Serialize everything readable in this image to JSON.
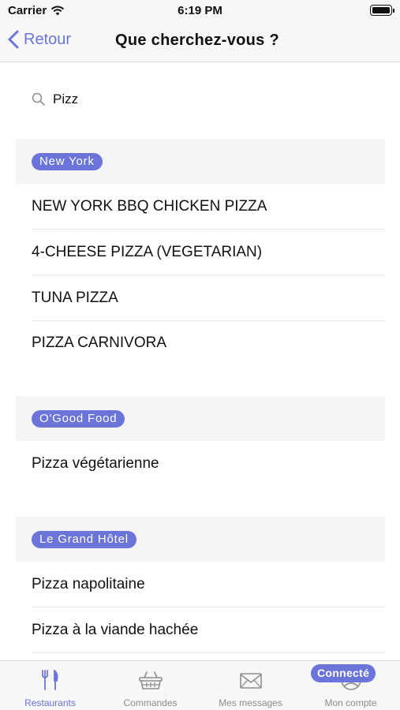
{
  "status_bar": {
    "carrier": "Carrier",
    "time": "6:19 PM"
  },
  "nav": {
    "back_label": "Retour",
    "title": "Que cherchez-vous ?"
  },
  "search": {
    "value": "Pizz"
  },
  "sections": [
    {
      "restaurant": "New York",
      "items": [
        "NEW YORK BBQ CHICKEN PIZZA",
        "4-CHEESE PIZZA (VEGETARIAN)",
        "TUNA PIZZA",
        "PIZZA CARNIVORA"
      ]
    },
    {
      "restaurant": "O'Good Food",
      "items": [
        "Pizza végétarienne"
      ]
    },
    {
      "restaurant": "Le Grand Hôtel",
      "items": [
        "Pizza napolitaine",
        "Pizza à la viande hachée"
      ]
    }
  ],
  "tab_bar": {
    "tabs": [
      {
        "label": "Restaurants",
        "icon": "fork-knife-icon",
        "active": true
      },
      {
        "label": "Commandes",
        "icon": "basket-icon",
        "active": false
      },
      {
        "label": "Mes messages",
        "icon": "envelope-icon",
        "active": false
      },
      {
        "label": "Mon compte",
        "icon": "account-icon",
        "active": false
      }
    ],
    "connected_badge": "Connecté"
  },
  "colors": {
    "accent": "#6b74d9",
    "inactive": "#8e8e93",
    "section_bg": "#f5f5f7"
  }
}
